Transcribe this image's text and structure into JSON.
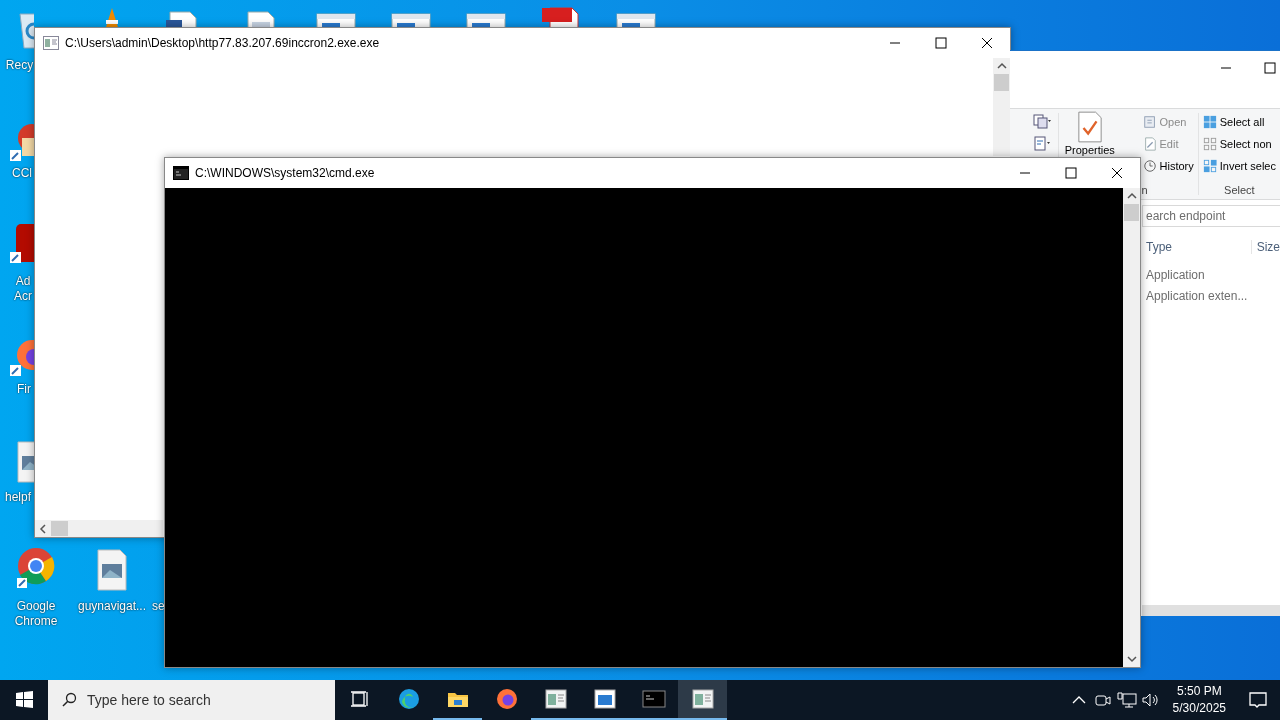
{
  "desktop_icons": [
    {
      "kind": "recycle-bin",
      "lines": [
        "Recy"
      ]
    },
    {
      "kind": "cone"
    },
    {
      "kind": "word-doc"
    },
    {
      "kind": "doc"
    },
    {
      "kind": "app-window"
    },
    {
      "kind": "app-window"
    },
    {
      "kind": "app-window"
    },
    {
      "kind": "pdf"
    },
    {
      "kind": "app-window"
    },
    {
      "kind": "ccleaner",
      "lines": [
        "CCl"
      ]
    },
    {
      "kind": "acrobat",
      "lines": [
        "Ad",
        "Acr"
      ]
    },
    {
      "kind": "firefox",
      "lines": [
        "Fir"
      ]
    },
    {
      "kind": "image-file",
      "lines": [
        "helpf"
      ]
    },
    {
      "kind": "chrome",
      "lines": [
        "Google",
        "Chrome"
      ]
    },
    {
      "kind": "image-file",
      "lines": [
        "guynavigat..."
      ]
    },
    {
      "kind": "none",
      "lines": [
        "se"
      ]
    }
  ],
  "console_window": {
    "title": "C:\\Users\\admin\\Desktop\\http77.83.207.69inccron2.exe.exe"
  },
  "explorer_window": {
    "properties": {
      "label": "Properties"
    },
    "open_group": {
      "items": [
        {
          "label": "Open",
          "kind": "open",
          "disabled": true
        },
        {
          "label": "Edit",
          "kind": "edit",
          "disabled": true
        },
        {
          "label": "History",
          "kind": "history",
          "disabled": false
        }
      ],
      "group_label": "n"
    },
    "select_group": {
      "items": [
        {
          "label": "Select all",
          "kind": "select-all"
        },
        {
          "label": "Select non",
          "kind": "select-none"
        },
        {
          "label": "Invert selec",
          "kind": "invert"
        }
      ],
      "group_label": "Select"
    },
    "search": {
      "placeholder": "earch endpoint"
    },
    "columns": [
      "Type",
      "Size"
    ],
    "rows": [
      {
        "type": "Application"
      },
      {
        "type": "Application exten..."
      }
    ]
  },
  "cmd_window": {
    "title": "C:\\WINDOWS\\system32\\cmd.exe"
  },
  "taskbar": {
    "search": {
      "placeholder": "Type here to search"
    },
    "apps": [
      {
        "kind": "task-view",
        "running": false,
        "selected": false
      },
      {
        "kind": "edge",
        "running": false,
        "selected": false
      },
      {
        "kind": "folder",
        "running": true,
        "selected": false
      },
      {
        "kind": "firefox",
        "running": false,
        "selected": false
      },
      {
        "kind": "app-window",
        "running": true,
        "selected": false
      },
      {
        "kind": "framed-app",
        "running": true,
        "selected": false
      },
      {
        "kind": "console",
        "running": true,
        "selected": false
      },
      {
        "kind": "app-window",
        "running": true,
        "selected": true
      }
    ],
    "time": "5:50 PM",
    "date": "5/30/2025"
  }
}
